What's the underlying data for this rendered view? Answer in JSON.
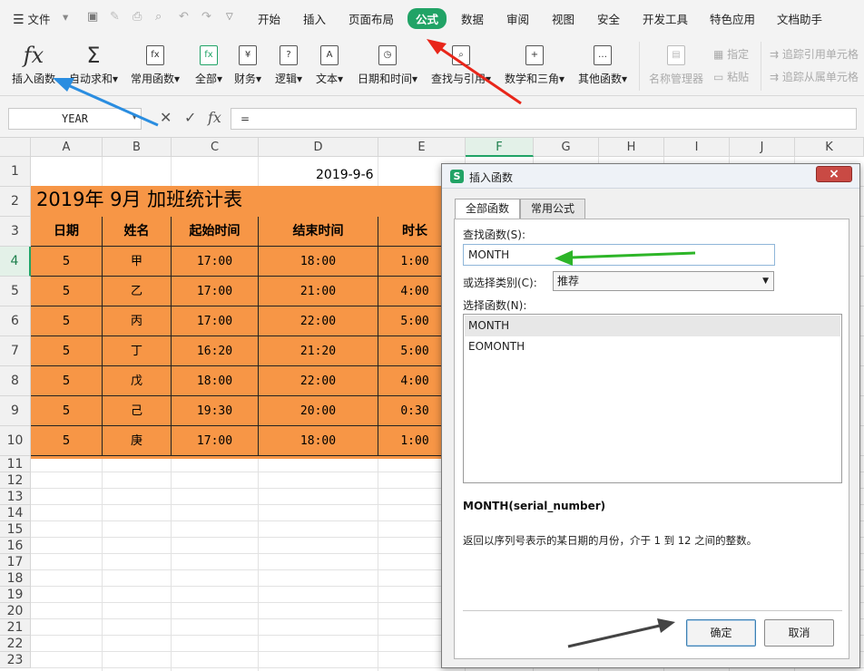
{
  "menubar": {
    "file_label": "文件",
    "tabs": [
      "开始",
      "插入",
      "页面布局",
      "公式",
      "数据",
      "审阅",
      "视图",
      "安全",
      "开发工具",
      "特色应用",
      "文档助手"
    ],
    "active_tab": "公式",
    "active_color": "#21a366"
  },
  "ribbon": {
    "insert_function": "插入函数",
    "autosum": "自动求和",
    "common_functions": "常用函数",
    "all": "全部",
    "financial": "财务",
    "logical": "逻辑",
    "text": "文本",
    "datetime": "日期和时间",
    "lookup": "查找与引用",
    "math": "数学和三角",
    "other": "其他函数",
    "name_manager": "名称管理器",
    "define": "指定",
    "paste": "粘贴",
    "trace_precedents": "追踪引用单元格",
    "trace_dependents": "追踪从属单元格"
  },
  "formula_bar": {
    "name_box": "YEAR",
    "fx_symbol": "fx",
    "content": "="
  },
  "sheet": {
    "columns": [
      "A",
      "B",
      "C",
      "D",
      "E",
      "F",
      "G",
      "H",
      "I",
      "J",
      "K"
    ],
    "selected_column": "F",
    "selected_row": 4,
    "rows": [
      "1",
      "2",
      "3",
      "4",
      "5",
      "6",
      "7",
      "8",
      "9",
      "10",
      "11",
      "12",
      "13",
      "14",
      "15",
      "16",
      "17",
      "18",
      "19",
      "20",
      "21",
      "22",
      "23"
    ],
    "date": "2019-9-6",
    "title": "2019年    9月    加班统计表",
    "fill_color": "#f79646",
    "headers": [
      "日期",
      "姓名",
      "起始时间",
      "结束时间",
      "时长"
    ],
    "data": [
      [
        "5",
        "甲",
        "17:00",
        "18:00",
        "1:00"
      ],
      [
        "5",
        "乙",
        "17:00",
        "21:00",
        "4:00"
      ],
      [
        "5",
        "丙",
        "17:00",
        "22:00",
        "5:00"
      ],
      [
        "5",
        "丁",
        "16:20",
        "21:20",
        "5:00"
      ],
      [
        "5",
        "戊",
        "18:00",
        "22:00",
        "4:00"
      ],
      [
        "5",
        "己",
        "19:30",
        "20:00",
        "0:30"
      ],
      [
        "5",
        "庚",
        "17:00",
        "18:00",
        "1:00"
      ]
    ]
  },
  "dialog": {
    "title": "插入函数",
    "logo": "S",
    "close": "×",
    "tabs": [
      "全部函数",
      "常用公式"
    ],
    "search_label": "查找函数(S):",
    "search_value": "MONTH",
    "category_label": "或选择类别(C):",
    "category_value": "推荐",
    "list_label": "选择函数(N):",
    "functions": [
      "MONTH",
      "EOMONTH"
    ],
    "signature": "MONTH(serial_number)",
    "description": "返回以序列号表示的某日期的月份，介于 1 到 12 之间的整数。",
    "ok": "确定",
    "cancel": "取消"
  }
}
